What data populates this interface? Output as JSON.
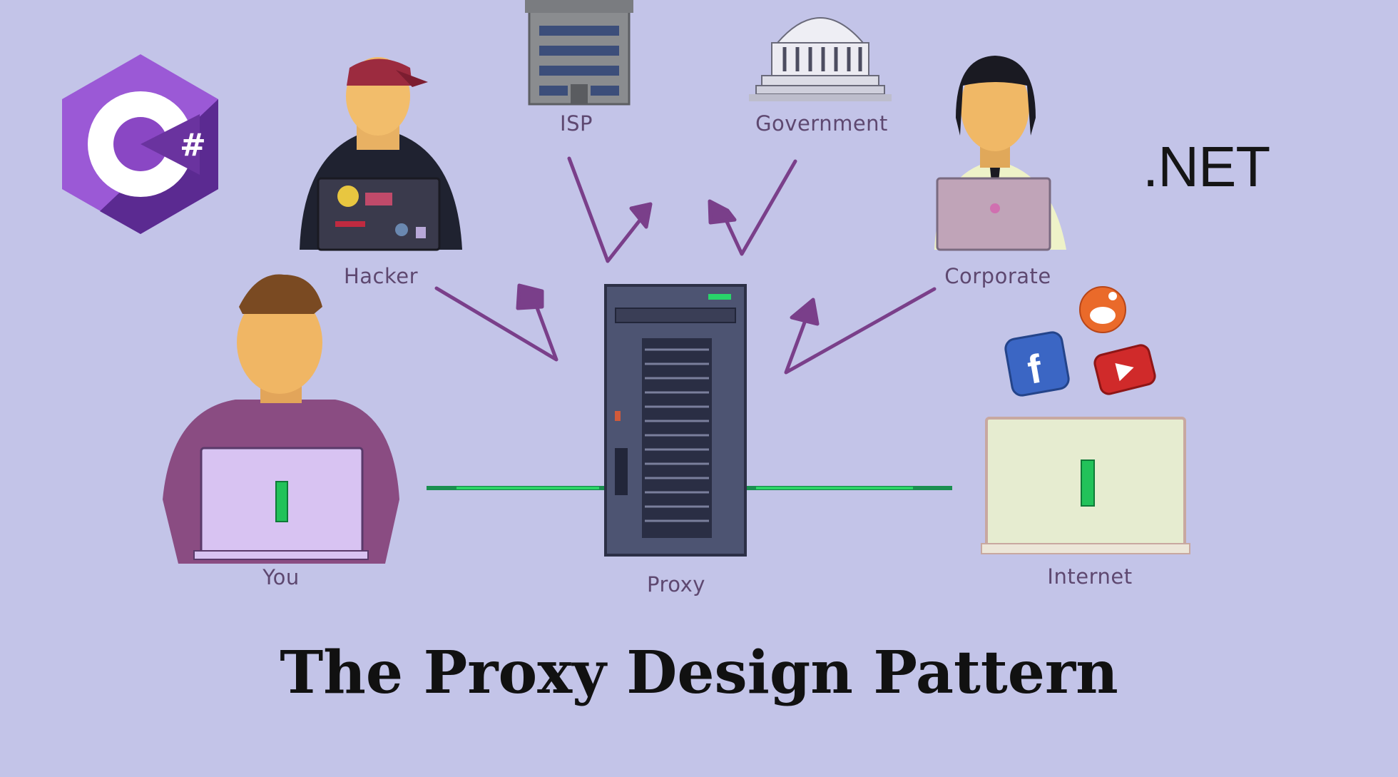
{
  "title": "The Proxy Design Pattern",
  "logos": {
    "csharp": "C#",
    "dotnet": ".NET"
  },
  "actors": {
    "you": "You",
    "proxy": "Proxy",
    "internet": "Internet",
    "hacker": "Hacker",
    "isp": "ISP",
    "government": "Government",
    "corporate": "Corporate"
  },
  "colors": {
    "background": "#c3c4e8",
    "arrow": "#7a3f8a",
    "connection": "#1fd45a",
    "csharp_light": "#9b4fcf",
    "csharp_dark": "#5b2a91"
  },
  "icons": [
    "reddit-icon",
    "facebook-icon",
    "youtube-icon"
  ]
}
